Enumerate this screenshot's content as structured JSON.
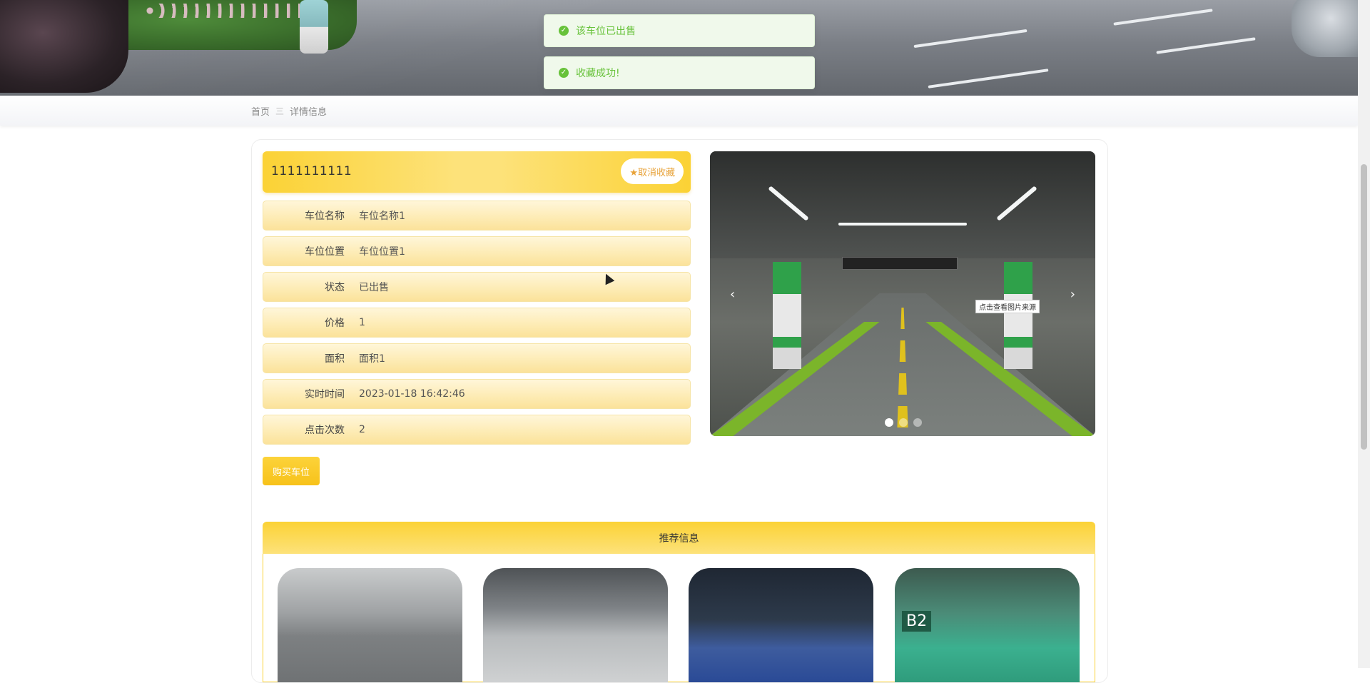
{
  "toasts": [
    {
      "message": "该车位已出售"
    },
    {
      "message": "收藏成功!"
    }
  ],
  "breadcrumb": {
    "home": "首页",
    "separator": "三",
    "current": "详情信息"
  },
  "detail": {
    "title": "1111111111",
    "favorite_button": "★取消收藏",
    "fields": [
      {
        "label": "车位名称",
        "value": "车位名称1"
      },
      {
        "label": "车位位置",
        "value": "车位位置1"
      },
      {
        "label": "状态",
        "value": "已出售"
      },
      {
        "label": "价格",
        "value": "1"
      },
      {
        "label": "面积",
        "value": "面积1"
      },
      {
        "label": "实时时间",
        "value": "2023-01-18 16:42:46"
      },
      {
        "label": "点击次数",
        "value": "2"
      }
    ],
    "buy_button": "购买车位"
  },
  "carousel": {
    "prev": "‹",
    "next": "›",
    "source_hint": "点击查看图片来源",
    "slide_count": 3,
    "active_index": 0
  },
  "recommend": {
    "title": "推荐信息",
    "items": [
      {
        "image": "parking-garage-1"
      },
      {
        "image": "parking-garage-2"
      },
      {
        "image": "parking-lot-night"
      },
      {
        "image": "parking-garage-b2",
        "tag": "B2"
      }
    ]
  },
  "colors": {
    "accent": "#fbd235",
    "success": "#67c23a",
    "toast_bg": "#f0f9eb"
  }
}
